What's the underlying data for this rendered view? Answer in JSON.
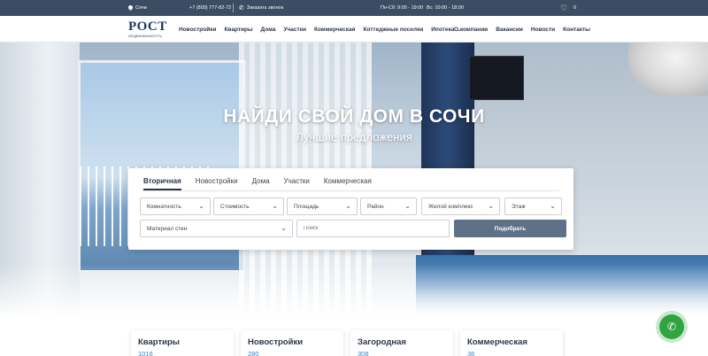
{
  "topbar": {
    "city": "Сочи",
    "phone": "+7 (800) 777-82-72",
    "callback": "Заказать звонок",
    "hours_weekdays": "Пн-Сб: 9:00 - 19:00",
    "hours_sunday": "Вс: 10:00 - 18:00",
    "favorites_count": "0",
    "icons": [
      "location-pin-icon",
      "phone-icon",
      "heart-icon"
    ]
  },
  "logo": {
    "word": "РОСТ",
    "sub": "НЕДВИЖИМОСТЬ"
  },
  "nav": {
    "items": [
      "Новостройки",
      "Квартиры",
      "Дома",
      "Участки",
      "Коммерческая",
      "Коттеджные поселки",
      "Ипотека"
    ],
    "right": [
      "О компании",
      "Вакансии",
      "Новости",
      "Контакты"
    ]
  },
  "hero": {
    "title": "НАЙДИ СВОЙ ДОМ В СОЧИ",
    "subtitle": "Лучшие предложения"
  },
  "search": {
    "tabs": [
      "Вторичная",
      "Новостройки",
      "Дома",
      "Участки",
      "Коммерческая"
    ],
    "active_tab": "Вторичная",
    "filters": [
      "Комнатность",
      "Стоимость",
      "Площадь",
      "Район",
      "Жилой комплекс",
      "Этаж"
    ],
    "wall_material": "Материал стен",
    "search_placeholder": "Поиск",
    "submit": "Подобрать"
  },
  "categories": [
    {
      "title": "Квартиры",
      "count": "1016"
    },
    {
      "title": "Новостройки",
      "count": "280"
    },
    {
      "title": "Загородная",
      "count": "308"
    },
    {
      "title": "Коммерческая",
      "count": "36"
    }
  ],
  "colors": {
    "topbar": "#3b4c63",
    "button": "#5e7186",
    "accent_link": "#3f7fb8",
    "call_fab": "#2fa43f"
  }
}
